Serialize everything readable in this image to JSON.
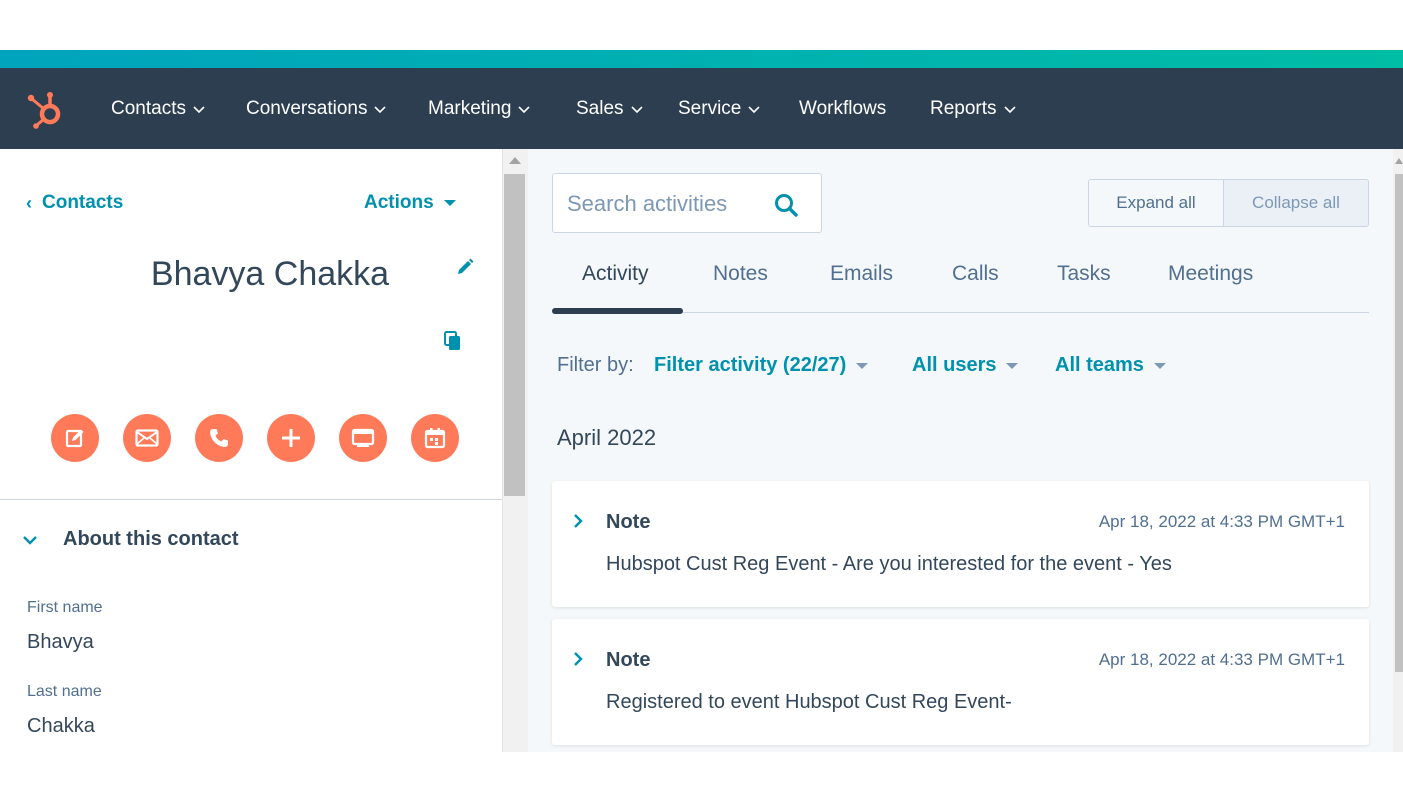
{
  "colors": {
    "nav_bg": "#2d3e50",
    "accent_teal": "#0091ae",
    "action_orange": "#ff7a59",
    "strip_gradient_start": "#00a4bd",
    "strip_gradient_end": "#00bda5"
  },
  "nav": {
    "logo_icon": "hubspot-sprocket-icon",
    "items": [
      {
        "label": "Contacts",
        "has_dropdown": true
      },
      {
        "label": "Conversations",
        "has_dropdown": true
      },
      {
        "label": "Marketing",
        "has_dropdown": true
      },
      {
        "label": "Sales",
        "has_dropdown": true
      },
      {
        "label": "Service",
        "has_dropdown": true
      },
      {
        "label": "Workflows",
        "has_dropdown": false
      },
      {
        "label": "Reports",
        "has_dropdown": true
      }
    ]
  },
  "record": {
    "back_label": "Contacts",
    "actions_label": "Actions",
    "name": "Bhavya Chakka",
    "action_buttons": [
      {
        "name": "note",
        "icon": "edit-note-icon"
      },
      {
        "name": "email",
        "icon": "email-icon"
      },
      {
        "name": "call",
        "icon": "phone-icon"
      },
      {
        "name": "add",
        "icon": "plus-icon"
      },
      {
        "name": "log-activity",
        "icon": "log-activity-icon"
      },
      {
        "name": "meeting",
        "icon": "calendar-icon"
      }
    ],
    "about_title": "About this contact",
    "properties": [
      {
        "label": "First name",
        "value": "Bhavya"
      },
      {
        "label": "Last name",
        "value": "Chakka"
      }
    ]
  },
  "activity": {
    "search_placeholder": "Search activities",
    "expand_label": "Expand all",
    "collapse_label": "Collapse all",
    "tabs": [
      {
        "label": "Activity",
        "active": true
      },
      {
        "label": "Notes",
        "active": false
      },
      {
        "label": "Emails",
        "active": false
      },
      {
        "label": "Calls",
        "active": false
      },
      {
        "label": "Tasks",
        "active": false
      },
      {
        "label": "Meetings",
        "active": false
      }
    ],
    "filter_label": "Filter by:",
    "filters": [
      {
        "label": "Filter activity (22/27)"
      },
      {
        "label": "All users"
      },
      {
        "label": "All teams"
      }
    ],
    "month": "April 2022",
    "items": [
      {
        "type": "Note",
        "timestamp": "Apr 18, 2022 at 4:33 PM GMT+1",
        "body": "Hubspot Cust Reg Event - Are you interested for the event - Yes"
      },
      {
        "type": "Note",
        "timestamp": "Apr 18, 2022 at 4:33 PM GMT+1",
        "body": "Registered to event Hubspot Cust Reg Event-"
      }
    ]
  }
}
